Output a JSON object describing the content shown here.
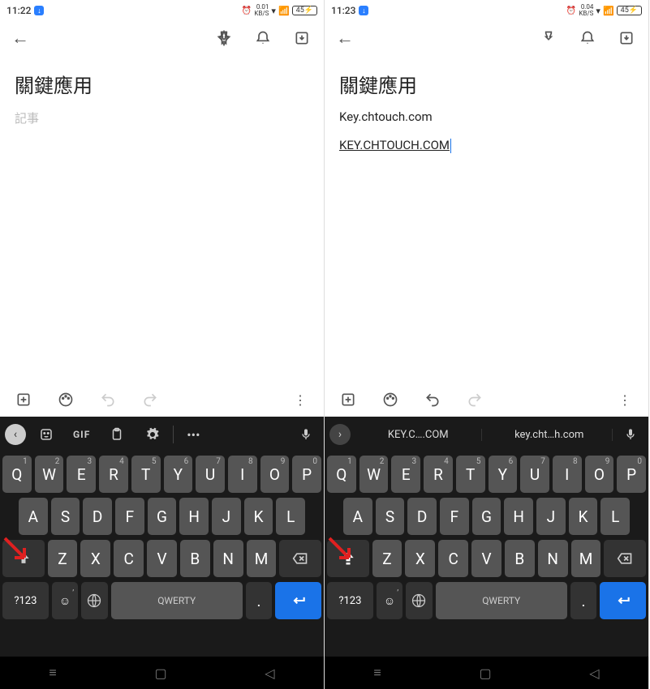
{
  "left": {
    "status": {
      "time": "11:22",
      "kbs_top": "0.01",
      "kbs_bot": "KB/S",
      "battery": "45"
    },
    "title": "關鍵應用",
    "placeholder": "記事",
    "suggest_bar": {
      "mode": "icons",
      "gif": "GIF"
    },
    "suggestions": [],
    "shift_caps": false
  },
  "right": {
    "status": {
      "time": "11:23",
      "kbs_top": "0.04",
      "kbs_bot": "KB/S",
      "battery": "45"
    },
    "title": "關鍵應用",
    "body1": "Key.chtouch.com",
    "body2": "KEY.CHTOUCH.COM",
    "suggest_bar": {
      "mode": "text"
    },
    "suggestions": [
      "KEY.C….COM",
      "key.cht…h.com"
    ],
    "shift_caps": true
  },
  "keys": {
    "row1": [
      {
        "c": "Q",
        "n": "1"
      },
      {
        "c": "W",
        "n": "2"
      },
      {
        "c": "E",
        "n": "3"
      },
      {
        "c": "R",
        "n": "4"
      },
      {
        "c": "T",
        "n": "5"
      },
      {
        "c": "Y",
        "n": "6"
      },
      {
        "c": "U",
        "n": "7"
      },
      {
        "c": "I",
        "n": "8"
      },
      {
        "c": "O",
        "n": "9"
      },
      {
        "c": "P",
        "n": "0"
      }
    ],
    "row2": [
      "A",
      "S",
      "D",
      "F",
      "G",
      "H",
      "J",
      "K",
      "L"
    ],
    "row3": [
      "Z",
      "X",
      "C",
      "V",
      "B",
      "N",
      "M"
    ],
    "symbols": "?123",
    "space": "QWERTY",
    "period": "."
  }
}
